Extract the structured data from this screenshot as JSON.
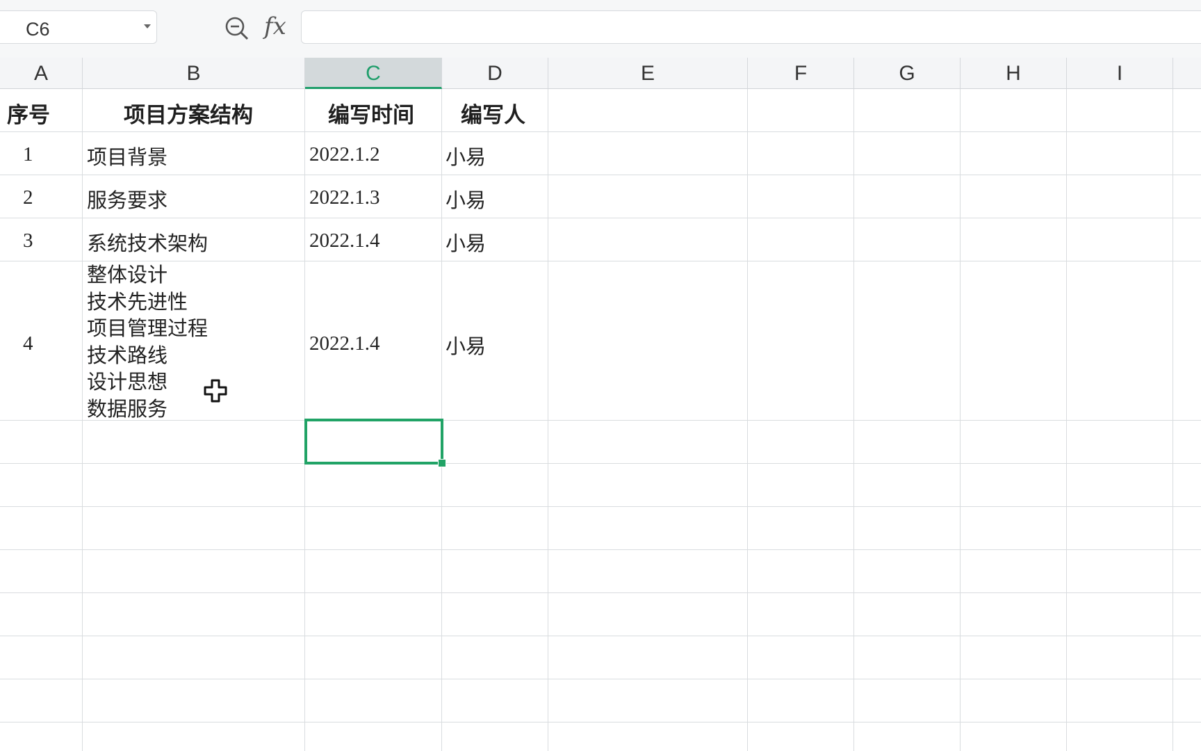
{
  "formula_bar": {
    "name_box": "C6",
    "zoom_icon": "zoom-formula-icon",
    "fx_label": "fx",
    "formula_value": ""
  },
  "columns": [
    "A",
    "B",
    "C",
    "D",
    "E",
    "F",
    "G",
    "H",
    "I"
  ],
  "active_column": "C",
  "table": {
    "headers": [
      "序号",
      "项目方案结构",
      "编写时间",
      "编写人"
    ],
    "rows": [
      {
        "no": "1",
        "structure": "项目背景",
        "date": "2022.1.2",
        "author": "小易"
      },
      {
        "no": "2",
        "structure": "服务要求",
        "date": "2022.1.3",
        "author": "小易"
      },
      {
        "no": "3",
        "structure": "系统技术架构",
        "date": "2022.1.4",
        "author": "小易"
      },
      {
        "no": "4",
        "structure": "整体设计\n技术先进性\n项目管理过程\n技术路线\n设计思想\n数据服务",
        "date": "2022.1.4",
        "author": "小易"
      }
    ]
  },
  "selected_cell": "C6",
  "colors": {
    "selection": "#21a366",
    "header_bg": "#f4f5f7",
    "grid": "#d9dcdf"
  }
}
